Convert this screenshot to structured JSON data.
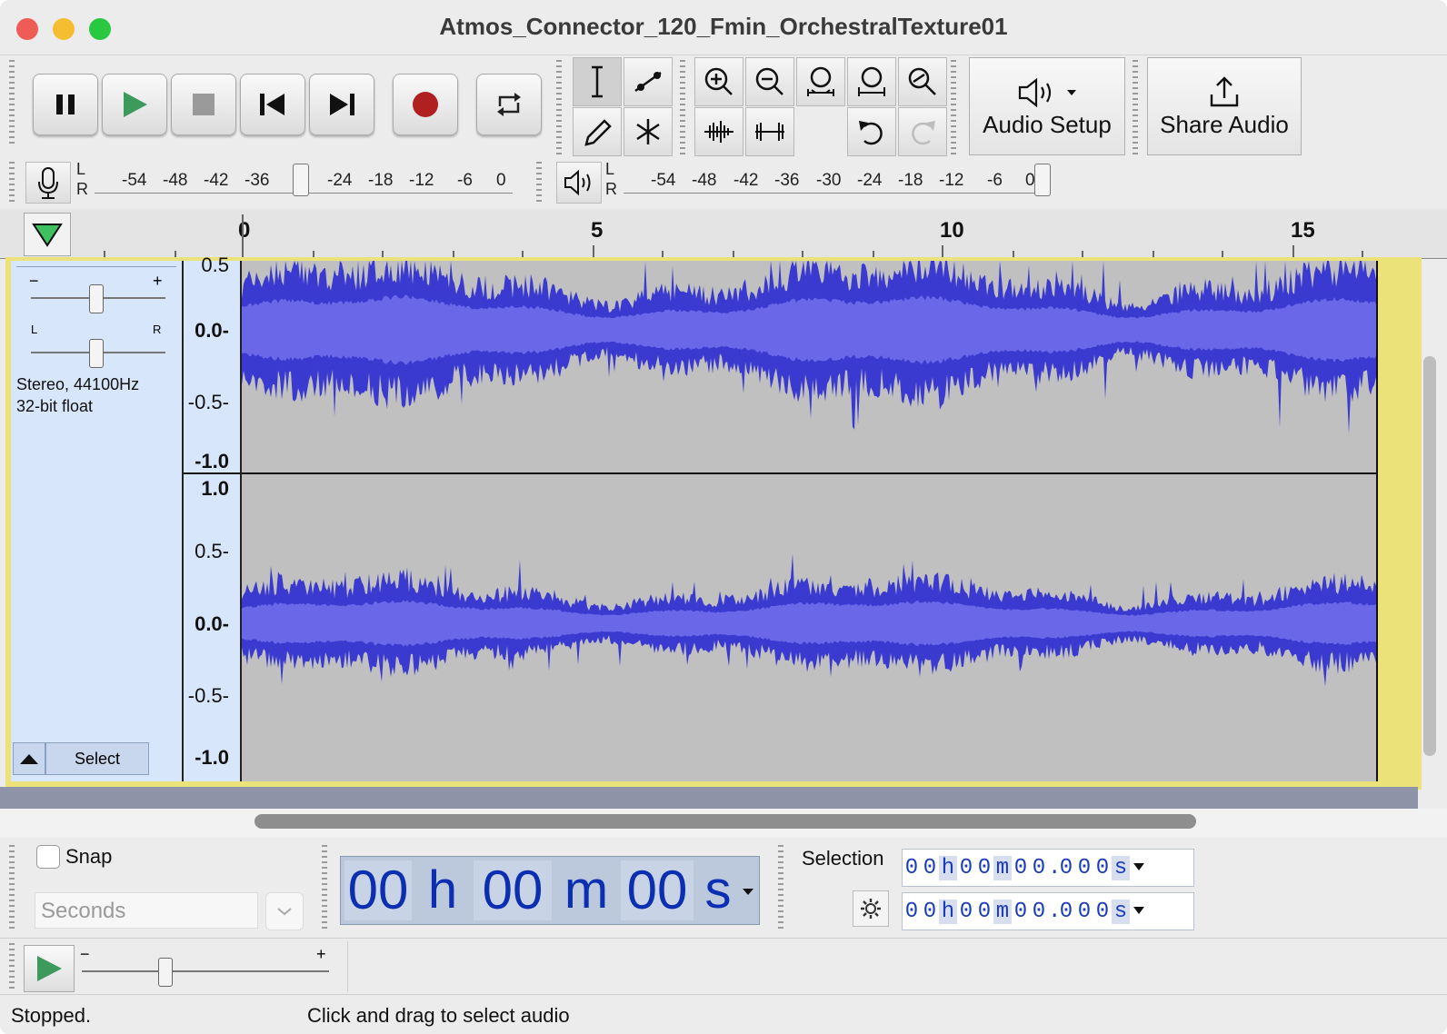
{
  "window": {
    "title": "Atmos_Connector_120_Fmin_OrchestralTexture01"
  },
  "colors": {
    "waveform_dark": "#3a3ad0",
    "waveform_light": "#6a68e8",
    "track_bg": "#c0c0c0",
    "track_panel": "#d8e6fb",
    "selection_border": "#ece27a",
    "record_red": "#b02020",
    "play_green": "#3c9a5c",
    "timecode_blue": "#0b2fb0"
  },
  "transport": {
    "buttons": [
      "pause",
      "play",
      "stop",
      "skip-to-start",
      "skip-to-end",
      "record",
      "loop"
    ]
  },
  "tools": {
    "items": [
      "selection-tool",
      "envelope-tool",
      "draw-tool",
      "multi-tool"
    ]
  },
  "edit": {
    "items": [
      "zoom-in",
      "zoom-out",
      "fit-selection",
      "fit-project",
      "zoom-toggle",
      "trim-audio",
      "silence-audio",
      "undo",
      "redo"
    ]
  },
  "audio_setup": {
    "label": "Audio Setup"
  },
  "share_audio": {
    "label": "Share Audio"
  },
  "record_meter": {
    "L": "L",
    "R": "R",
    "ticks": [
      "-54",
      "-48",
      "-42",
      "-36",
      "-24",
      "-18",
      "-12",
      "-6",
      "0"
    ]
  },
  "play_meter": {
    "L": "L",
    "R": "R",
    "ticks": [
      "-54",
      "-48",
      "-42",
      "-36",
      "-30",
      "-24",
      "-18",
      "-12",
      "-6",
      "0"
    ]
  },
  "ruler": {
    "labels": [
      "0",
      "5",
      "10",
      "15"
    ]
  },
  "track": {
    "gain_minus": "−",
    "gain_plus": "+",
    "pan_left": "L",
    "pan_right": "R",
    "format_line1": "Stereo, 44100Hz",
    "format_line2": "32-bit float",
    "select_label": "Select",
    "ch1_scale": [
      "0.5",
      "0.0-",
      "-0.5-",
      "-1.0"
    ],
    "ch2_scale": [
      "1.0",
      "0.5-",
      "0.0-",
      "-0.5-",
      "-1.0"
    ]
  },
  "snap": {
    "label": "Snap",
    "checked": false,
    "unit": "Seconds"
  },
  "time_display": {
    "hh": "00",
    "h": "h",
    "mm": "00",
    "m": "m",
    "ss": "00",
    "s": "s"
  },
  "selection": {
    "label": "Selection",
    "start": [
      "0",
      "0",
      "h",
      "0",
      "0",
      "m",
      "0",
      "0",
      ".",
      "0",
      "0",
      "0",
      "s"
    ],
    "end": [
      "0",
      "0",
      "h",
      "0",
      "0",
      "m",
      "0",
      "0",
      ".",
      "0",
      "0",
      "0",
      "s"
    ]
  },
  "play_at_speed": {
    "minus": "−",
    "plus": "+"
  },
  "status": {
    "state": "Stopped.",
    "hint": "Click and drag to select audio"
  }
}
